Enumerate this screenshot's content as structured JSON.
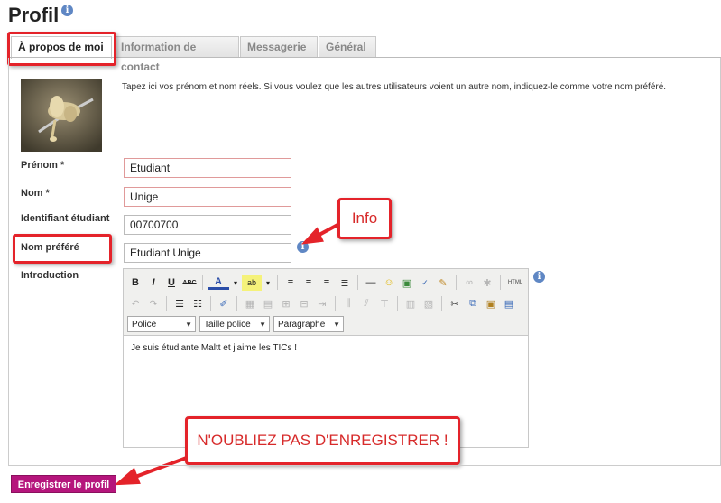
{
  "header": {
    "title": "Profil",
    "info_icon": "info-icon"
  },
  "tabs": [
    {
      "label": "À propos de moi",
      "active": true
    },
    {
      "label": "Information de contact",
      "active": false
    },
    {
      "label": "Messagerie",
      "active": false
    },
    {
      "label": "Général",
      "active": false
    }
  ],
  "profile": {
    "hint": "Tapez ici vos prénom et nom réels. Si vous voulez que les autres utilisateurs voient un autre nom, indiquez-le comme votre nom préféré.",
    "fields": {
      "prenom": {
        "label": "Prénom *",
        "value": "Etudiant"
      },
      "nom": {
        "label": "Nom *",
        "value": "Unige"
      },
      "identifiant": {
        "label": "Identifiant étudiant",
        "value": "00700700"
      },
      "nom_prefere": {
        "label": "Nom préféré",
        "value": "Etudiant Unige"
      },
      "introduction": {
        "label": "Introduction"
      }
    }
  },
  "editor": {
    "font_select": "Police",
    "size_select": "Taille police",
    "format_select": "Paragraphe",
    "content": "Je suis étudiante Maltt et j'aime les TICs !",
    "buttons": {
      "bold": "B",
      "italic": "I",
      "underline": "U",
      "strike": "ABC",
      "html": "HTML"
    }
  },
  "annotations": {
    "info_callout": "Info",
    "save_callout": "N'OUBLIEZ PAS D'ENREGISTRER !"
  },
  "actions": {
    "save_label": "Enregistrer le profil"
  },
  "colors": {
    "accent_red": "#e4232a",
    "save_button": "#b5157c",
    "info_blue": "#5f87c4"
  }
}
